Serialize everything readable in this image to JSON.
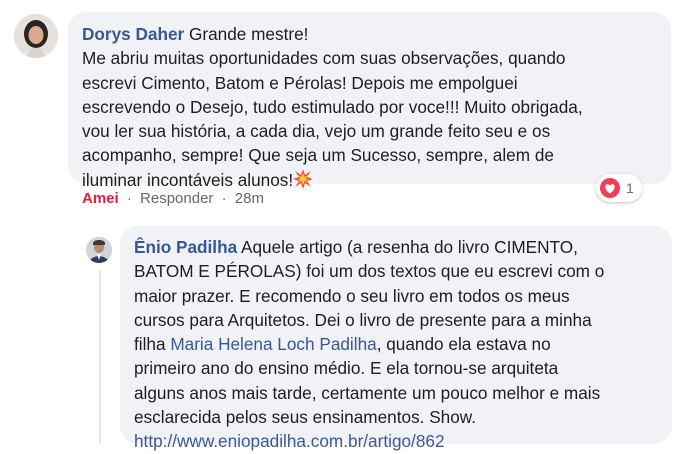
{
  "comment": {
    "author": "Dorys Daher",
    "lines": [
      "Grande mestre!",
      "Me abriu muitas oportunidades com suas observações, quando",
      "escrevi Cimento, Batom e Pérolas! Depois me empolguei",
      "escrevendo o Desejo, tudo estimulado por voce!!! Muito obrigada,",
      "vou ler sua história, a cada dia, vejo um grande feito seu e os",
      "acompanho, sempre! Que seja um Sucesso, sempre, alem de",
      "iluminar incontáveis alunos!"
    ],
    "emoji": "collision-emoji",
    "actions": {
      "like": "Amei",
      "reply": "Responder",
      "time": "28m"
    },
    "reactions": {
      "type": "heart",
      "count": "1",
      "color": "#f33e58"
    }
  },
  "reply": {
    "author": "Ênio Padilha",
    "line1": "Aquele artigo (a resenha do livro CIMENTO,",
    "line2": "BATOM E PÉROLAS) foi um dos textos que eu escrevi com o",
    "line3": "maior prazer. E recomendo o seu livro em todos os meus",
    "line4": "cursos para Arquitetos. Dei o livro de presente para a minha",
    "line5_prefix": "filha",
    "mention": "Maria Helena Loch Padilha",
    "line5_suffix": ", quando ela estava no",
    "line6": "primeiro ano do ensino médio. E ela tornou-se arquiteta",
    "line7": "alguns anos mais tarde, certamente um pouco melhor e mais",
    "line8": "esclarecida pelos seus ensinamentos. Show.",
    "link": "http://www.eniopadilha.com.br/artigo/862"
  },
  "colors": {
    "bubble": "#f0f2f5",
    "author": "#385898",
    "like": "#e41e3f",
    "meta": "#65676b"
  }
}
